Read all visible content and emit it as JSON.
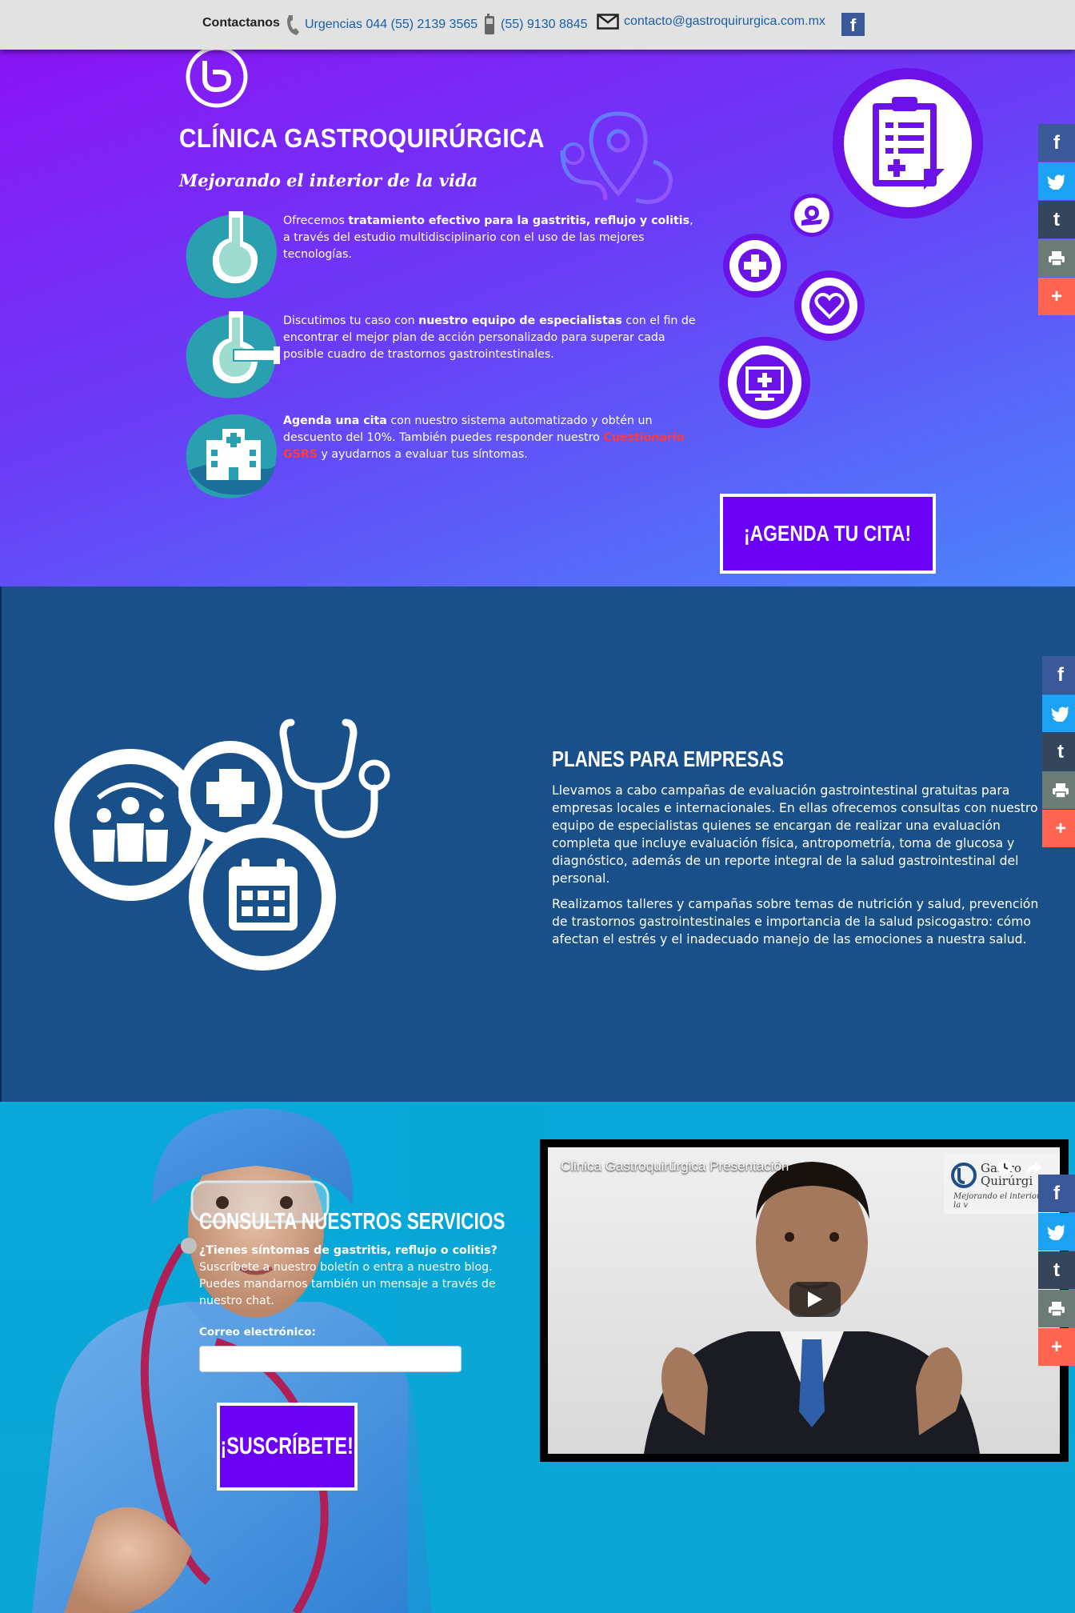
{
  "topbar": {
    "contact_label": "Contactanos",
    "urgencias": "Urgencias 044 (55) 2139 3565",
    "cell": "(55) 9130 8845",
    "email": "contacto@gastroquirurgica.com.mx",
    "facebook_glyph": "f"
  },
  "hero": {
    "title": "CLÍNICA GASTROQUIRÚRGICA",
    "subtitle": "Mejorando el interior de la vida",
    "features": [
      {
        "pre": "Ofrecemos ",
        "bold": "tratamiento efectivo para la gastritis, reflujo y colitis",
        "post": ", a través del estudio multidisciplinario con el uso de las mejores tecnologías."
      },
      {
        "pre": "Discutimos tu caso con ",
        "bold": "nuestro equipo de especialistas",
        "post": " con el fin de encontrar el mejor plan de acción personalizado para superar cada posible cuadro de trastornos gastrointestinales."
      },
      {
        "bold": "Agenda una cita",
        "post": " con nuestro sistema automatizado y obtén un descuento del 10%. También puedes responder nuestro ",
        "link": "Cuestionario GSRS",
        "post2": " y ayudarnos a evaluar tus síntomas."
      }
    ],
    "cta_label": "¡AGENDA TU CITA!"
  },
  "plans": {
    "title": "PLANES PARA EMPRESAS",
    "paragraph1": "Llevamos a cabo campañas de evaluación gastrointestinal gratuitas para empresas locales e internacionales. En ellas ofrecemos consultas con nuestro equipo de especialistas quienes se encargan de realizar una evaluación completa que incluye evaluación física, antropometría, toma de glucosa y diagnóstico, además de un reporte integral de la salud gastrointestinal del personal.",
    "paragraph2": "Realizamos talleres y campañas sobre temas de nutrición y salud, prevención de trastornos gastrointestinales e importancia de la salud psicogastro: cómo afectan el estrés y el inadecuado manejo de las emociones a nuestra salud."
  },
  "consult": {
    "title": "CONSULTA NUESTROS SERVICIOS",
    "question": "¿Tienes síntomas de gastritis, reflujo o colitis?",
    "text": "Suscríbete a nuestro boletín o entra a nuestro blog. Puedes mandarnos también un mensaje a través de nuestro chat.",
    "email_label": "Correo electrónico:",
    "email_value": "",
    "subscribe_label": "¡SUSCRÍBETE!"
  },
  "video": {
    "title": "Clinica Gastroquirúrgica Presentación",
    "logo_name_1": "Gastro",
    "logo_name_2": "Quirúrgi",
    "logo_tagline": "Mejorando el interior de la v"
  },
  "share": {
    "facebook": "f",
    "tumblr": "t",
    "more": "+"
  },
  "colors": {
    "accent_purple": "#6a00f4",
    "hero_gradient_start": "#8a14f5",
    "hero_gradient_end": "#4b86fb",
    "plans_bg": "#19508a",
    "consult_bg": "#08a8d8",
    "link_red": "#ff3b3b"
  },
  "icons": [
    "phone-icon",
    "mobile-icon",
    "mail-icon",
    "facebook-icon",
    "clipboard-icon",
    "plus-icon",
    "heart-icon",
    "monitor-icon",
    "stethoscope-icon",
    "calendar-icon",
    "team-icon",
    "play-icon",
    "clock-icon",
    "share-icon",
    "twitter-icon",
    "tumblr-icon",
    "print-icon"
  ]
}
